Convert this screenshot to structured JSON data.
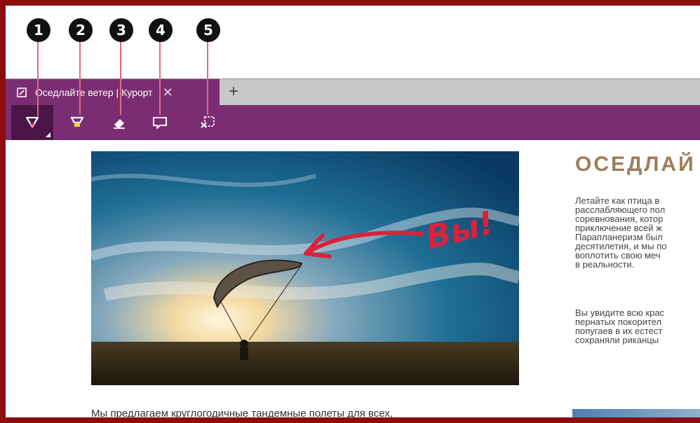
{
  "callouts": [
    "1",
    "2",
    "3",
    "4",
    "5"
  ],
  "tab": {
    "title": "Оседлайте ветер | Курорт",
    "close_glyph": "✕",
    "new_tab_glyph": "+"
  },
  "toolbar": {
    "tools": [
      {
        "name": "pen",
        "icon": "pen-icon",
        "color": "#e0324a"
      },
      {
        "name": "highlighter",
        "icon": "highlighter-icon",
        "color": "#f3d43a"
      },
      {
        "name": "eraser",
        "icon": "eraser-icon",
        "color": "#ffffff"
      },
      {
        "name": "note",
        "icon": "comment-icon",
        "color": "#ffffff"
      },
      {
        "name": "clip",
        "icon": "clip-icon",
        "color": "#ffffff"
      }
    ]
  },
  "hero": {
    "annotation": "Вы!",
    "annotation_color": "#d8233a"
  },
  "article": {
    "heading": "ОСЕДЛАЙ",
    "paragraphs": [
      "Летайте как птица в\nрасслабляющего пол\nсоревнования, котор\nприключение всей ж",
      "Парапланеризм был\nдесятилетия, и мы по\nвоплотить свою меч\nв реальности.",
      "Вы увидите всю крас\nпернатых покорител\nпопугаев в их естест\nсохраняли риканцы"
    ],
    "caption": "Мы предлагаем круглогодичные тандемные полеты для всех,\nкто хочет ощутить"
  },
  "colors": {
    "frame": "#8b0d0d",
    "accent": "#7b2d73",
    "accent_dark": "#4a1546",
    "heading": "#9b7e59"
  }
}
